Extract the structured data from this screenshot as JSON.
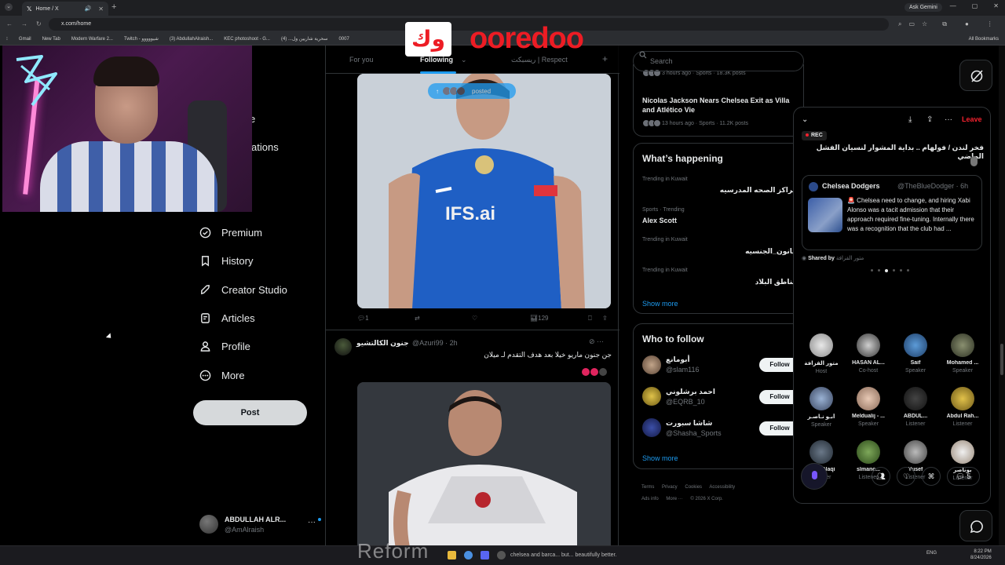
{
  "browser": {
    "tab_title": "Home / X",
    "url": "x.com/home",
    "ask_gemini": "Ask Gemini",
    "bookmarks": [
      "Gmail",
      "New Tab",
      "Modern Warfare 2...",
      "Twitch - شيووووو",
      "(3) AbdullahAlraish...",
      "KEC photoshoot - G...",
      "سحرية شاريين ول... (4)",
      "0007"
    ],
    "all_bookmarks": "All Bookmarks"
  },
  "sponsor": {
    "arabic": "وك",
    "brand": "ooredoo"
  },
  "left_nav": {
    "partial_items": [
      "e",
      "ations"
    ],
    "items": [
      {
        "label": "Premium",
        "icon": "premium-icon"
      },
      {
        "label": "History",
        "icon": "bookmark-icon"
      },
      {
        "label": "Creator Studio",
        "icon": "rocket-icon"
      },
      {
        "label": "Articles",
        "icon": "articles-icon"
      },
      {
        "label": "Profile",
        "icon": "person-icon"
      },
      {
        "label": "More",
        "icon": "more-circle-icon"
      }
    ],
    "post_button": "Post",
    "account": {
      "name": "ABDULLAH ALR...",
      "handle": "@AmAlraish"
    }
  },
  "timeline": {
    "tabs": [
      "For you",
      "Following",
      "ريسبكت | Respect"
    ],
    "posted_pill": "posted",
    "tweet1_actions": {
      "replies": "1",
      "views": "129"
    },
    "tweet2": {
      "name": "جنون الكالتشيو",
      "handle": "@Azuri99",
      "time": "· 2h",
      "text": "جن جنون ماريو خيلا بعد هدف التقدم لـ ميلان"
    }
  },
  "right_sidebar": {
    "search_placeholder": "Search",
    "top_meta": "3 hours ago · Sports · 18.3K posts",
    "news_title": "Nicolas Jackson Nears Chelsea Exit as Villa and Atlético Vie",
    "news_meta": "13 hours ago · Sports · 11.2K posts",
    "whats_happening": {
      "title": "What’s happening",
      "trends": [
        {
          "meta": "Trending in Kuwait",
          "name": "مراكز الصحه المدرسيه"
        },
        {
          "meta": "Sports · Trending",
          "name": "Alex Scott"
        },
        {
          "meta": "Trending in Kuwait",
          "name": "قانون_الجنسيه"
        },
        {
          "meta": "Trending in Kuwait",
          "name": "مناطق البلاد"
        }
      ],
      "show_more": "Show more"
    },
    "who_to_follow": {
      "title": "Who to follow",
      "users": [
        {
          "name": "أبومانع",
          "handle": "@slam116",
          "follow": "Follow"
        },
        {
          "name": "احمد برشلوني",
          "handle": "@EQRB_10",
          "follow": "Follow"
        },
        {
          "name": "شاشا سبورت",
          "handle": "@Shasha_Sports",
          "follow": "Follow"
        }
      ],
      "show_more": "Show more"
    },
    "footer": [
      "Terms",
      "Privacy",
      "Cookies",
      "Accessibility",
      "Ads info",
      "More ···",
      "© 2026 X Corp."
    ]
  },
  "space": {
    "leave": "Leave",
    "rec": "REC",
    "title": "فخر لندن / فولهام .. بداية المشوار لنسيان الفشل الماضي",
    "shared_tweet": {
      "name": "Chelsea Dodgers",
      "handle": "@TheBlueDodger · 6h",
      "text": "🚨 Chelsea need to change, and hiring Xabi Alonso was a tacit admission that their approach required fine-tuning. Internally there was a recognition that the club had ..."
    },
    "shared_by_label": "Shared by",
    "shared_by_name": "متور القزافة",
    "participants": [
      {
        "name": "متور القزافة",
        "role": "Host"
      },
      {
        "name": "HASAN AL...",
        "role": "Co-host"
      },
      {
        "name": "Saif",
        "role": "Speaker"
      },
      {
        "name": "Mohamed ...",
        "role": "Speaker"
      },
      {
        "name": "أبـو نـاصـر",
        "role": "Speaker"
      },
      {
        "name": "Meldualij - ...",
        "role": "Speaker"
      },
      {
        "name": "ABDUL...",
        "role": "Listener"
      },
      {
        "name": "Abdul Rah...",
        "role": "Listener"
      },
      {
        "name": "Ali Al-Naqi",
        "role": "Listener"
      },
      {
        "name": "slmanc...",
        "role": "Listener"
      },
      {
        "name": "Yusef",
        "role": "Listener"
      },
      {
        "name": "بوناصر",
        "role": "Listener"
      }
    ],
    "comments_count": "5"
  },
  "taskbar": {
    "reform_text": "Reform",
    "status_text": "chelsea and barca... but... beautifully better.",
    "lang": "ENG",
    "time": "8:22 PM",
    "date": "8/24/2026"
  }
}
